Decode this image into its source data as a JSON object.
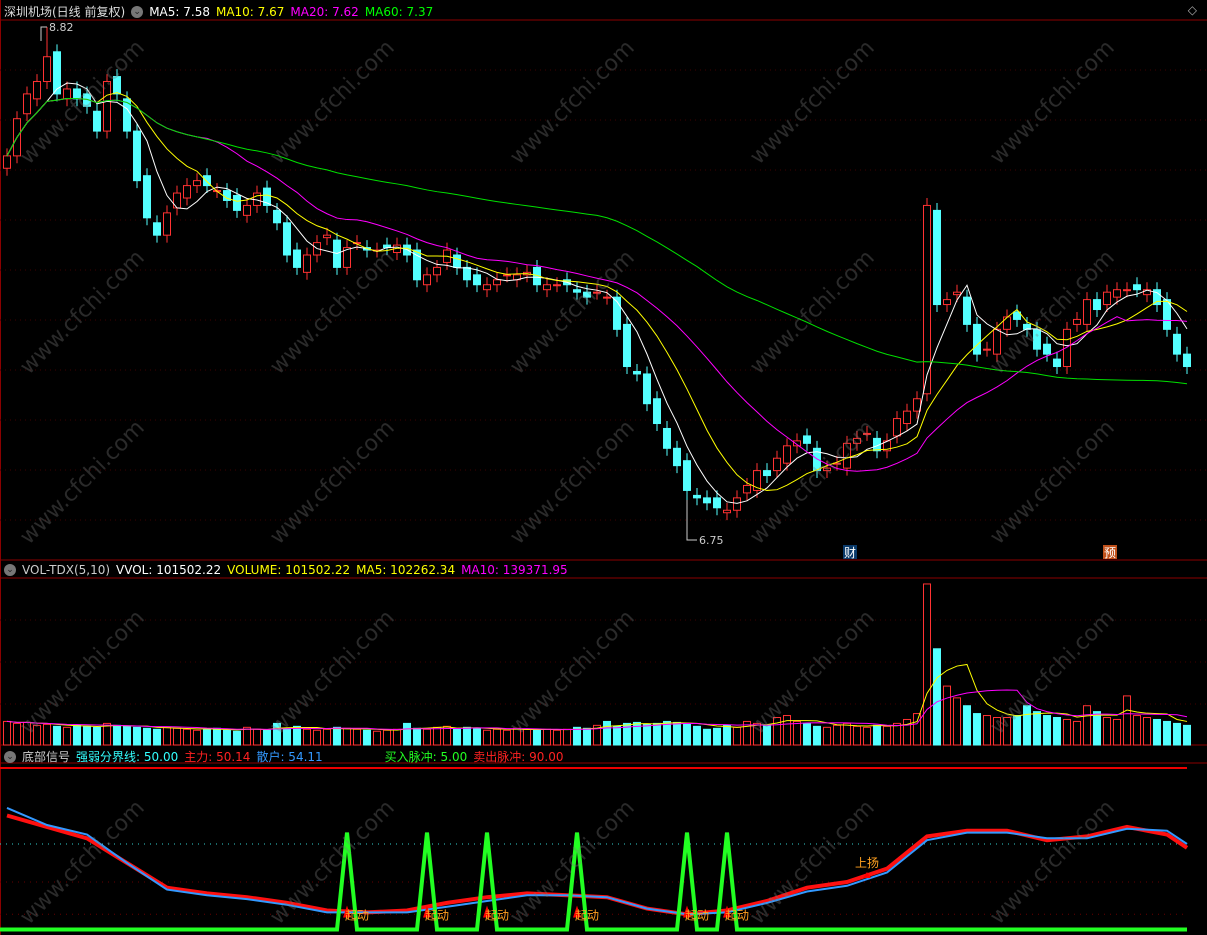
{
  "header": {
    "title": "深圳机场(日线 前复权)",
    "ma5": "MA5: 7.58",
    "ma10": "MA10: 7.67",
    "ma20": "MA20: 7.62",
    "ma60": "MA60: 7.37"
  },
  "volume_header": {
    "name": "VOL-TDX(5,10)",
    "vvol": "VVOL: 101502.22",
    "volume": "VOLUME: 101502.22",
    "ma5": "MA5: 102262.34",
    "ma10": "MA10: 139371.95"
  },
  "indicator_header": {
    "name": "底部信号",
    "divider": "强弱分界线: 50.00",
    "main": "主力: 50.14",
    "retail": "散户: 54.11",
    "buy": "买入脉冲: 5.00",
    "sell": "卖出脉冲: 90.00"
  },
  "markers": {
    "high_label": "8.82",
    "low_label": "6.75",
    "finance": "财",
    "forecast": "预",
    "start": "起动",
    "rise": "上扬"
  },
  "watermark": "www.cfchi.com",
  "colors": {
    "up": "#ff3232",
    "down": "#54ffff",
    "ma5": "#ffffff",
    "ma10": "#ffff00",
    "ma20": "#ff00ff",
    "ma60": "#00e000",
    "main": "#ff1010",
    "retail": "#3399ff",
    "pulse": "#22ff22"
  },
  "chart_data": [
    {
      "type": "candlestick",
      "title": "深圳机场(日线 前复权)",
      "ylim": [
        6.67,
        8.93
      ],
      "high": 8.82,
      "high_index": 4,
      "low": 6.75,
      "low_index": 68,
      "close": [
        8.3,
        8.45,
        8.55,
        8.6,
        8.7,
        8.55,
        8.57,
        8.53,
        8.5,
        8.4,
        8.6,
        8.55,
        8.4,
        8.2,
        8.05,
        7.98,
        8.07,
        8.15,
        8.18,
        8.2,
        8.18,
        8.16,
        8.12,
        8.08,
        8.1,
        8.15,
        8.1,
        8.03,
        7.9,
        7.85,
        7.9,
        7.95,
        7.98,
        7.85,
        7.93,
        7.95,
        7.92,
        7.92,
        7.93,
        7.94,
        7.9,
        7.8,
        7.82,
        7.85,
        7.92,
        7.85,
        7.8,
        7.78,
        7.78,
        7.8,
        7.82,
        7.82,
        7.83,
        7.78,
        7.78,
        7.78,
        7.78,
        7.75,
        7.73,
        7.75,
        7.73,
        7.6,
        7.45,
        7.42,
        7.3,
        7.22,
        7.12,
        7.05,
        6.95,
        6.92,
        6.9,
        6.88,
        6.87,
        6.92,
        6.97,
        7.03,
        7.01,
        7.08,
        7.13,
        7.15,
        7.14,
        7.03,
        7.04,
        7.06,
        7.14,
        7.16,
        7.18,
        7.11,
        7.15,
        7.24,
        7.27,
        7.32,
        8.1,
        7.7,
        7.72,
        7.75,
        7.62,
        7.5,
        7.52,
        7.6,
        7.65,
        7.64,
        7.6,
        7.52,
        7.5,
        7.45,
        7.6,
        7.64,
        7.72,
        7.68,
        7.75,
        7.76,
        7.76,
        7.76,
        7.76,
        7.7,
        7.6,
        7.5,
        7.45
      ],
      "finance_index": 84,
      "forecast_index": 110
    },
    {
      "type": "bar",
      "title": "VOL-TDX(5,10)",
      "ylim": [
        0,
        830000
      ],
      "values": [
        120000,
        110000,
        115000,
        100000,
        105000,
        95000,
        90000,
        100000,
        95000,
        90000,
        110000,
        100000,
        95000,
        90000,
        85000,
        80000,
        90000,
        85000,
        80000,
        75000,
        80000,
        85000,
        75000,
        70000,
        90000,
        80000,
        75000,
        110000,
        85000,
        95000,
        80000,
        75000,
        80000,
        90000,
        85000,
        80000,
        75000,
        70000,
        75000,
        80000,
        110000,
        85000,
        80000,
        90000,
        95000,
        80000,
        90000,
        85000,
        75000,
        80000,
        75000,
        85000,
        80000,
        75000,
        80000,
        75000,
        80000,
        90000,
        85000,
        100000,
        120000,
        95000,
        110000,
        115000,
        105000,
        110000,
        120000,
        115000,
        110000,
        95000,
        80000,
        85000,
        100000,
        90000,
        120000,
        110000,
        100000,
        140000,
        150000,
        120000,
        110000,
        95000,
        90000,
        100000,
        110000,
        95000,
        90000,
        100000,
        95000,
        110000,
        130000,
        160000,
        820000,
        490000,
        300000,
        240000,
        200000,
        160000,
        150000,
        140000,
        140000,
        150000,
        200000,
        170000,
        150000,
        140000,
        130000,
        120000,
        200000,
        170000,
        140000,
        130000,
        250000,
        150000,
        140000,
        130000,
        120000,
        110000,
        100000
      ]
    },
    {
      "type": "line",
      "title": "底部信号",
      "ylim": [
        0,
        90
      ],
      "x": [
        0,
        4,
        8,
        12,
        16,
        20,
        24,
        28,
        32,
        36,
        40,
        44,
        48,
        52,
        56,
        60,
        64,
        68,
        72,
        76,
        80,
        84,
        88,
        92,
        96,
        100,
        104,
        108,
        112,
        116,
        118
      ],
      "series": [
        {
          "name": "主力",
          "values": [
            65,
            59,
            53,
            40,
            27,
            24,
            22,
            19,
            15,
            14,
            15,
            19,
            22,
            24,
            23,
            22,
            16,
            13,
            15,
            20,
            27,
            30,
            37,
            54,
            57,
            57,
            52,
            54,
            59,
            55,
            48
          ]
        },
        {
          "name": "散户",
          "values": [
            69,
            60,
            55,
            40,
            26,
            23,
            21,
            18,
            14,
            14,
            14,
            17,
            20,
            23,
            23,
            22,
            16,
            13,
            14,
            19,
            25,
            28,
            35,
            52,
            56,
            56,
            53,
            53,
            58,
            57,
            50
          ]
        }
      ],
      "divider": 50,
      "sell_line": 90,
      "pulse_base": 5,
      "pulse_peak": 56,
      "pulse_indices": [
        34,
        42,
        48,
        57,
        68,
        72
      ],
      "rise_index": 86
    }
  ]
}
